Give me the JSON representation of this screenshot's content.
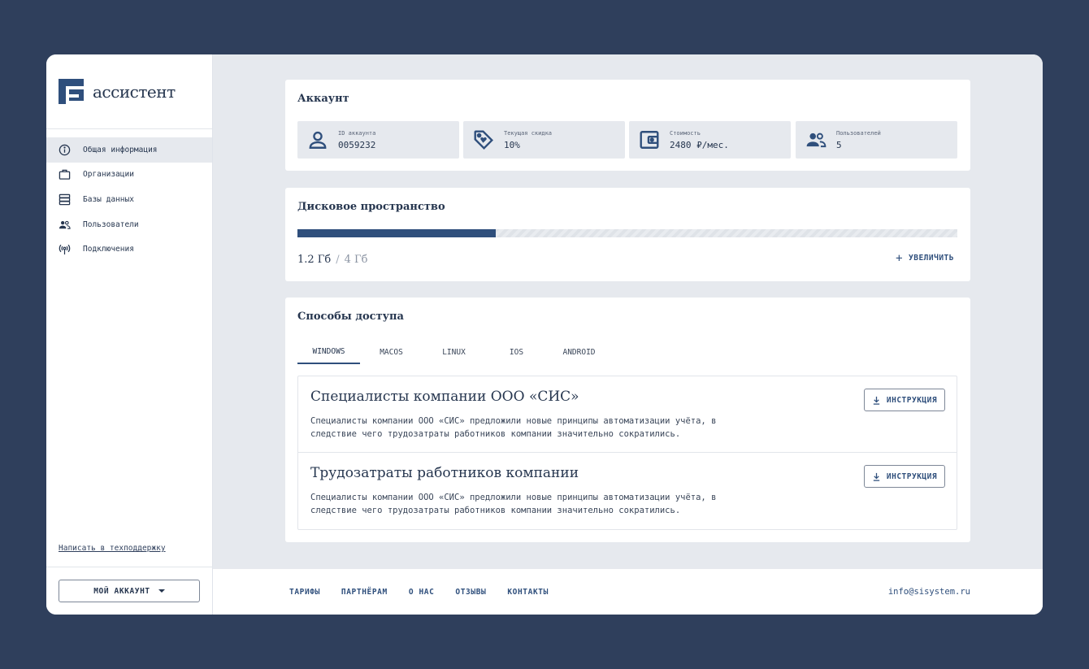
{
  "brand": {
    "name": "ассистент"
  },
  "sidebar": {
    "items": [
      {
        "label": "Общая информация",
        "icon": "info-icon",
        "active": true
      },
      {
        "label": "Организации",
        "icon": "briefcase-icon"
      },
      {
        "label": "Базы данных",
        "icon": "database-icon"
      },
      {
        "label": "Пользователи",
        "icon": "users-icon"
      },
      {
        "label": "Подключения",
        "icon": "antenna-icon"
      }
    ],
    "support_link": "Написать в техподдержку",
    "account_button": "МОЙ АККАУНТ"
  },
  "account": {
    "title": "Аккаунт",
    "stats": [
      {
        "label": "ID аккаунта",
        "value": "0059232",
        "icon": "person-icon"
      },
      {
        "label": "Текущая скидка",
        "value": "10%",
        "icon": "discount-tag-icon"
      },
      {
        "label": "Стоимость",
        "value": "2480 ₽/мес.",
        "icon": "wallet-icon"
      },
      {
        "label": "Пользователей",
        "value": "5",
        "icon": "group-icon"
      }
    ]
  },
  "disk": {
    "title": "Дисковое пространство",
    "used": "1.2 Гб",
    "separator": "/",
    "total": "4 Гб",
    "used_fraction": 0.3,
    "increase_label": "УВЕЛИЧИТЬ"
  },
  "access": {
    "title": "Способы доступа",
    "tabs": [
      "WINDOWS",
      "MACOS",
      "LINUX",
      "IOS",
      "ANDROID"
    ],
    "active_tab": 0,
    "items": [
      {
        "title": "Специалисты компании ООО «СИС»",
        "text": "Специалисты компании ООО «СИС» предложили новые принципы автоматизации учёта, в следствие чего трудозатраты работников компании значительно сократились.",
        "button": "ИНСТРУКЦИЯ"
      },
      {
        "title": "Трудозатраты работников компании",
        "text": "Специалисты компании ООО «СИС» предложили новые принципы автоматизации учёта, в следствие чего трудозатраты работников компании значительно сократились.",
        "button": "ИНСТРУКЦИЯ"
      }
    ]
  },
  "footer": {
    "links": [
      "ТАРИФЫ",
      "ПАРТНЁРАМ",
      "О НАС",
      "ОТЗЫВЫ",
      "КОНТАКТЫ"
    ],
    "email": "info@sisystem.ru"
  },
  "colors": {
    "background": "#2f3f5c",
    "accent": "#2f4f7c",
    "panel": "#e6e9ee"
  }
}
